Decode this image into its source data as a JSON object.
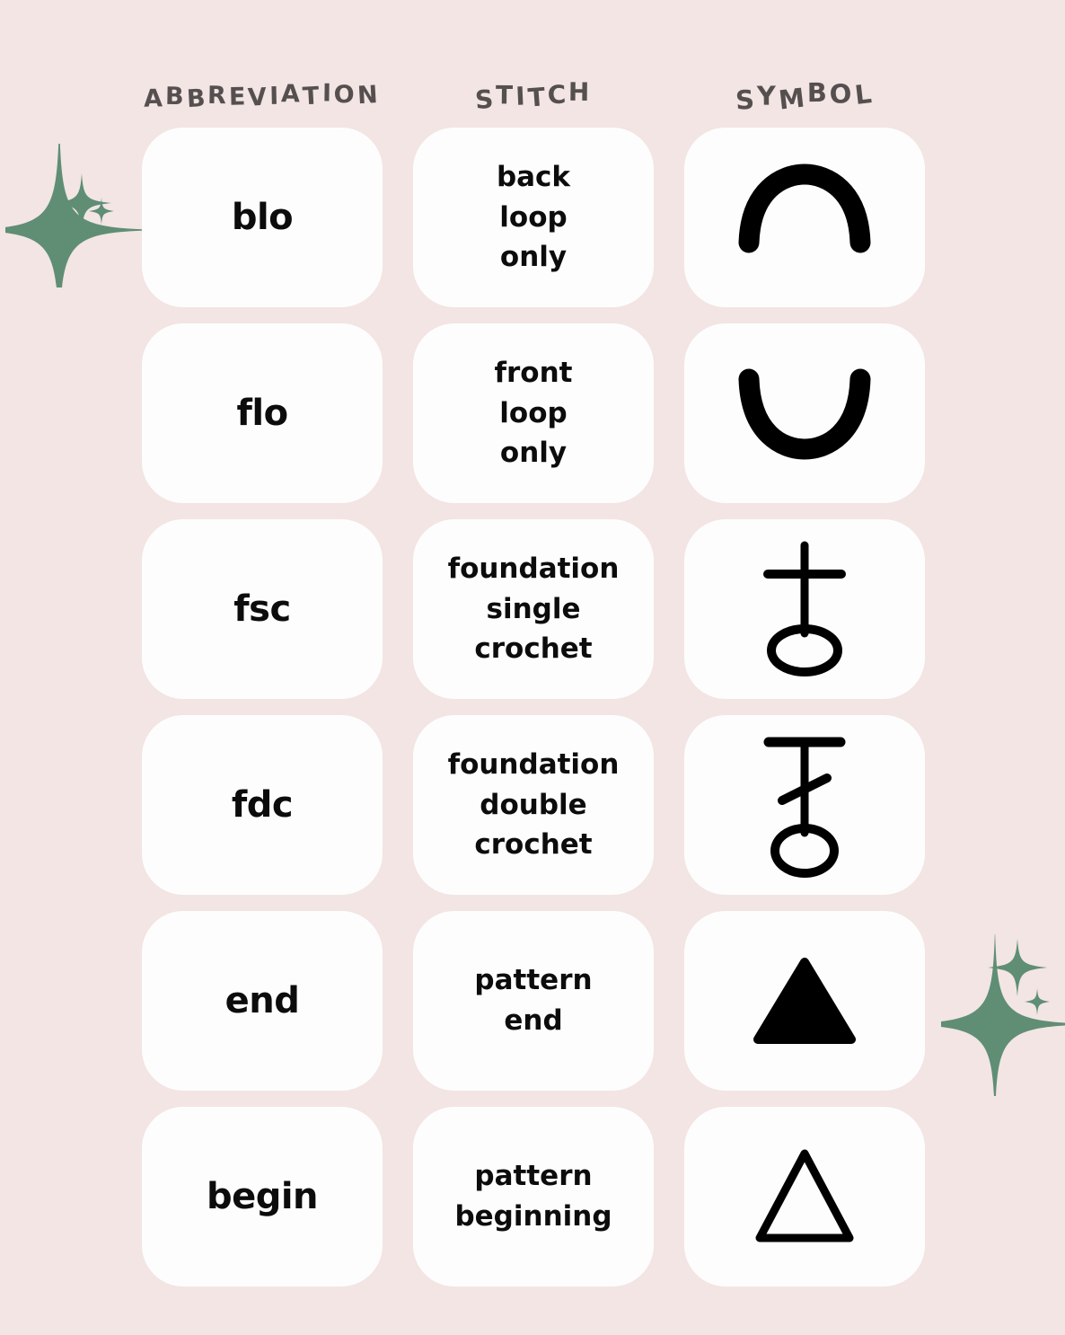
{
  "palette": {
    "background": "#f2e5e4",
    "card": "#fefdfd",
    "text": "#0c0c0c",
    "header_text": "#55504f",
    "sparkle_green": "#5f8e74",
    "symbol_ink": "#000000"
  },
  "headers": {
    "abbreviation": "ABBREVIATION",
    "stitch": "STITCH",
    "symbol": "SYMBOL"
  },
  "decorations": [
    {
      "name": "sparkle-cluster-left",
      "position": "top-left",
      "color": "#5f8e74"
    },
    {
      "name": "sparkle-cluster-right",
      "position": "bottom-right",
      "color": "#5f8e74"
    }
  ],
  "chart_data": {
    "type": "table",
    "title": "",
    "columns": [
      "ABBREVIATION",
      "STITCH",
      "SYMBOL"
    ],
    "rows": [
      {
        "abbreviation": "blo",
        "stitch": "back loop only",
        "symbol_name": "arc-up-icon"
      },
      {
        "abbreviation": "flo",
        "stitch": "front loop only",
        "symbol_name": "arc-down-icon"
      },
      {
        "abbreviation": "fsc",
        "stitch": "foundation single crochet",
        "symbol_name": "foundation-single-crochet-icon"
      },
      {
        "abbreviation": "fdc",
        "stitch": "foundation double crochet",
        "symbol_name": "foundation-double-crochet-icon"
      },
      {
        "abbreviation": "end",
        "stitch": "pattern end",
        "symbol_name": "triangle-filled-icon"
      },
      {
        "abbreviation": "begin",
        "stitch": "pattern beginning",
        "symbol_name": "triangle-outline-icon"
      }
    ]
  }
}
